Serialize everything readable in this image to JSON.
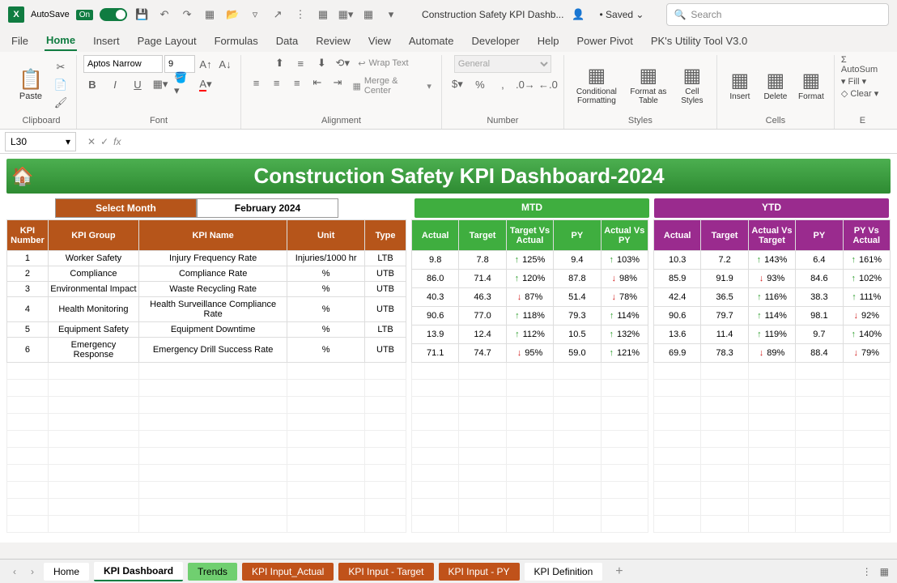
{
  "titlebar": {
    "autosave": "AutoSave",
    "toggle_state": "On",
    "doc_title": "Construction Safety KPI Dashb...",
    "saved": "Saved",
    "search_placeholder": "Search"
  },
  "ribbon_tabs": [
    "File",
    "Home",
    "Insert",
    "Page Layout",
    "Formulas",
    "Data",
    "Review",
    "View",
    "Automate",
    "Developer",
    "Help",
    "Power Pivot",
    "PK's Utility Tool V3.0"
  ],
  "ribbon": {
    "paste": "Paste",
    "clipboard": "Clipboard",
    "font_name": "Aptos Narrow",
    "font_size": "9",
    "font_group": "Font",
    "alignment": "Alignment",
    "wrap": "Wrap Text",
    "merge": "Merge & Center",
    "number_format": "General",
    "number": "Number",
    "cond_fmt": "Conditional Formatting",
    "fmt_table": "Format as Table",
    "cell_styles": "Cell Styles",
    "styles": "Styles",
    "insert": "Insert",
    "delete": "Delete",
    "format": "Format",
    "cells": "Cells",
    "autosum": "AutoSum",
    "fill": "Fill",
    "clear": "Clear"
  },
  "formula_bar": {
    "name_box": "L30",
    "formula": ""
  },
  "dashboard": {
    "title": "Construction Safety KPI Dashboard-2024",
    "select_month_label": "Select Month",
    "select_month_value": "February 2024",
    "mtd_label": "MTD",
    "ytd_label": "YTD",
    "left_headers": [
      "KPI Number",
      "KPI Group",
      "KPI Name",
      "Unit",
      "Type"
    ],
    "mtd_headers": [
      "Actual",
      "Target",
      "Target Vs Actual",
      "PY",
      "Actual Vs PY"
    ],
    "ytd_headers": [
      "Actual",
      "Target",
      "Actual Vs Target",
      "PY",
      "PY Vs Actual"
    ],
    "rows": [
      {
        "num": "1",
        "group": "Worker Safety",
        "name": "Injury Frequency Rate",
        "unit": "Injuries/1000 hr",
        "type": "LTB",
        "mtd": {
          "actual": "9.8",
          "target": "7.8",
          "tva": "125%",
          "tva_dir": "up",
          "py": "9.4",
          "avp": "103%",
          "avp_dir": "up"
        },
        "ytd": {
          "actual": "10.3",
          "target": "7.2",
          "avt": "143%",
          "avt_dir": "up",
          "py": "6.4",
          "pva": "161%",
          "pva_dir": "up"
        }
      },
      {
        "num": "2",
        "group": "Compliance",
        "name": "Compliance Rate",
        "unit": "%",
        "type": "UTB",
        "mtd": {
          "actual": "86.0",
          "target": "71.4",
          "tva": "120%",
          "tva_dir": "up",
          "py": "87.8",
          "avp": "98%",
          "avp_dir": "down"
        },
        "ytd": {
          "actual": "85.9",
          "target": "91.9",
          "avt": "93%",
          "avt_dir": "down",
          "py": "84.6",
          "pva": "102%",
          "pva_dir": "up"
        }
      },
      {
        "num": "3",
        "group": "Environmental Impact",
        "name": "Waste Recycling Rate",
        "unit": "%",
        "type": "UTB",
        "mtd": {
          "actual": "40.3",
          "target": "46.3",
          "tva": "87%",
          "tva_dir": "down",
          "py": "51.4",
          "avp": "78%",
          "avp_dir": "down"
        },
        "ytd": {
          "actual": "42.4",
          "target": "36.5",
          "avt": "116%",
          "avt_dir": "up",
          "py": "38.3",
          "pva": "111%",
          "pva_dir": "up"
        }
      },
      {
        "num": "4",
        "group": "Health Monitoring",
        "name": "Health Surveillance Compliance Rate",
        "unit": "%",
        "type": "UTB",
        "mtd": {
          "actual": "90.6",
          "target": "77.0",
          "tva": "118%",
          "tva_dir": "up",
          "py": "79.3",
          "avp": "114%",
          "avp_dir": "up"
        },
        "ytd": {
          "actual": "90.6",
          "target": "79.7",
          "avt": "114%",
          "avt_dir": "up",
          "py": "98.1",
          "pva": "92%",
          "pva_dir": "down"
        }
      },
      {
        "num": "5",
        "group": "Equipment Safety",
        "name": "Equipment Downtime",
        "unit": "%",
        "type": "LTB",
        "mtd": {
          "actual": "13.9",
          "target": "12.4",
          "tva": "112%",
          "tva_dir": "up",
          "py": "10.5",
          "avp": "132%",
          "avp_dir": "up"
        },
        "ytd": {
          "actual": "13.6",
          "target": "11.4",
          "avt": "119%",
          "avt_dir": "up",
          "py": "9.7",
          "pva": "140%",
          "pva_dir": "up"
        }
      },
      {
        "num": "6",
        "group": "Emergency Response",
        "name": "Emergency Drill Success Rate",
        "unit": "%",
        "type": "UTB",
        "mtd": {
          "actual": "71.1",
          "target": "74.7",
          "tva": "95%",
          "tva_dir": "down",
          "py": "59.0",
          "avp": "121%",
          "avp_dir": "up"
        },
        "ytd": {
          "actual": "69.9",
          "target": "78.3",
          "avt": "89%",
          "avt_dir": "down",
          "py": "88.4",
          "pva": "79%",
          "pva_dir": "down"
        }
      }
    ]
  },
  "sheet_tabs": {
    "home": "Home",
    "active": "KPI Dashboard",
    "trends": "Trends",
    "input_actual": "KPI Input_Actual",
    "input_target": "KPI Input - Target",
    "input_py": "KPI Input - PY",
    "definition": "KPI Definition"
  }
}
